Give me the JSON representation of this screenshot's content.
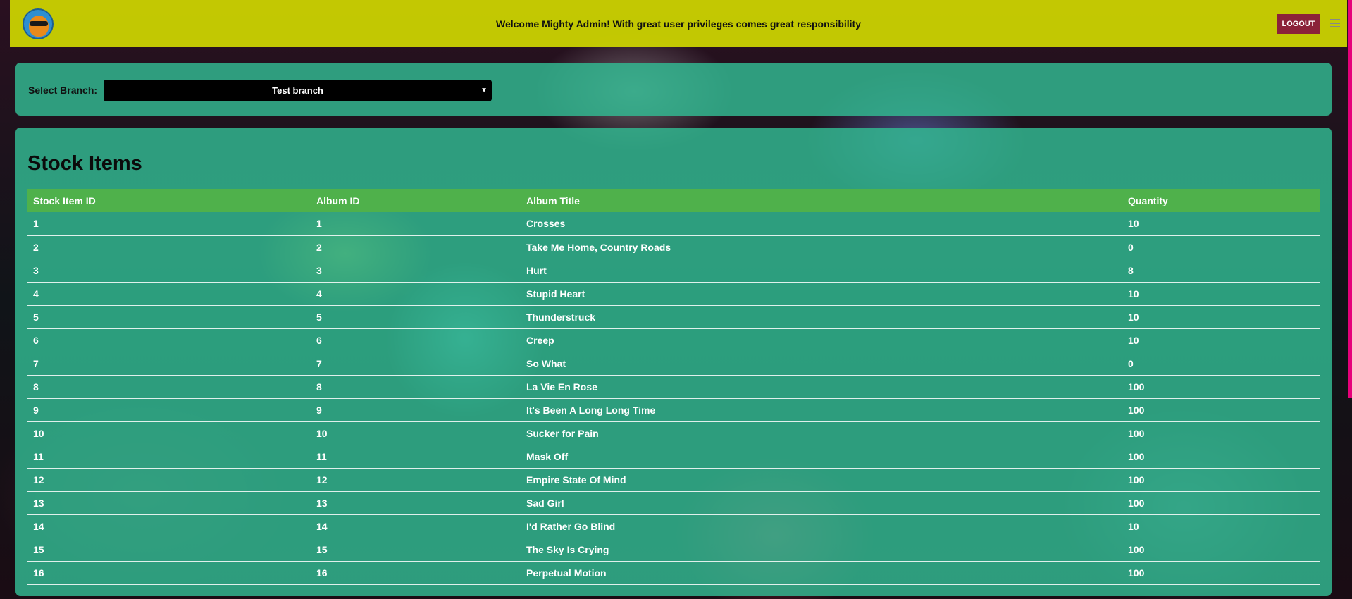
{
  "header": {
    "welcome": "Welcome Mighty Admin! With great user privileges comes great responsibility",
    "logout_label": "LOGOUT"
  },
  "branch": {
    "label": "Select Branch:",
    "selected": "Test branch"
  },
  "stock": {
    "title": "Stock Items",
    "columns": [
      "Stock Item ID",
      "Album ID",
      "Album Title",
      "Quantity"
    ],
    "rows": [
      [
        "1",
        "1",
        "Crosses",
        "10"
      ],
      [
        "2",
        "2",
        "Take Me Home, Country Roads",
        "0"
      ],
      [
        "3",
        "3",
        "Hurt",
        "8"
      ],
      [
        "4",
        "4",
        "Stupid Heart",
        "10"
      ],
      [
        "5",
        "5",
        "Thunderstruck",
        "10"
      ],
      [
        "6",
        "6",
        "Creep",
        "10"
      ],
      [
        "7",
        "7",
        "So What",
        "0"
      ],
      [
        "8",
        "8",
        "La Vie En Rose",
        "100"
      ],
      [
        "9",
        "9",
        "It's Been A Long Long Time",
        "100"
      ],
      [
        "10",
        "10",
        "Sucker for Pain",
        "100"
      ],
      [
        "11",
        "11",
        "Mask Off",
        "100"
      ],
      [
        "12",
        "12",
        "Empire State Of Mind",
        "100"
      ],
      [
        "13",
        "13",
        "Sad Girl",
        "100"
      ],
      [
        "14",
        "14",
        "I'd Rather Go Blind",
        "10"
      ],
      [
        "15",
        "15",
        "The Sky Is Crying",
        "100"
      ],
      [
        "16",
        "16",
        "Perpetual Motion",
        "100"
      ]
    ]
  }
}
